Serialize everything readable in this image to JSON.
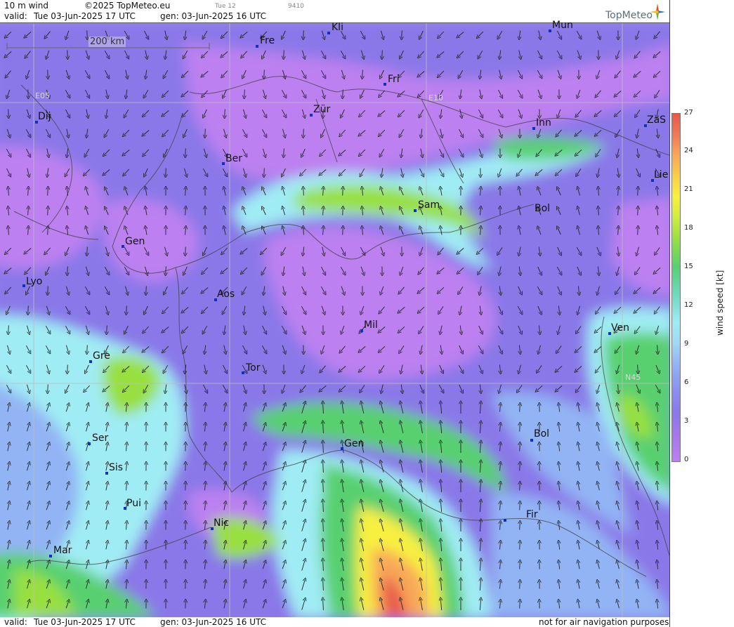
{
  "header": {
    "product": "10 m wind",
    "copyright": "©2025 TopMeteo.eu",
    "valid_label": "valid:",
    "valid_time": "Tue  03-Jun-2025  17 UTC",
    "gen_time": "gen: 03-Jun-2025 16 UTC",
    "small1": "Tue 12",
    "small2": "9410",
    "logo_text": "TopMeteo"
  },
  "footer": {
    "valid_label": "valid:",
    "valid_time": "Tue  03-Jun-2025  17 UTC",
    "gen_time": "gen: 03-Jun-2025 16 UTC",
    "disclaimer": "not for air navigation purposes"
  },
  "map": {
    "scale_label": "200 km",
    "grid_labels": [
      "E05",
      "E10",
      "N45"
    ],
    "cities": [
      "Kli",
      "Mun",
      "Fre",
      "Fri",
      "Dij",
      "Zür",
      "Inn",
      "ZaS",
      "Ber",
      "Lie",
      "Sam",
      "Bol",
      "Gen",
      "Lyo",
      "Aos",
      "Mil",
      "Ven",
      "Gre",
      "Tor",
      "Ser",
      "Gen",
      "Bol",
      "Sis",
      "Pui",
      "Nic",
      "Fir",
      "Mar"
    ]
  },
  "colorbar": {
    "label": "wind speed [kt]",
    "ticks": [
      "27",
      "24",
      "21",
      "18",
      "15",
      "12",
      "9",
      "6",
      "3",
      "0"
    ],
    "colors": [
      "#bc80f0",
      "#8a78e8",
      "#92b4f4",
      "#a0ecf4",
      "#58d070",
      "#98e040",
      "#f8f040",
      "#f8a858",
      "#e85848"
    ]
  }
}
